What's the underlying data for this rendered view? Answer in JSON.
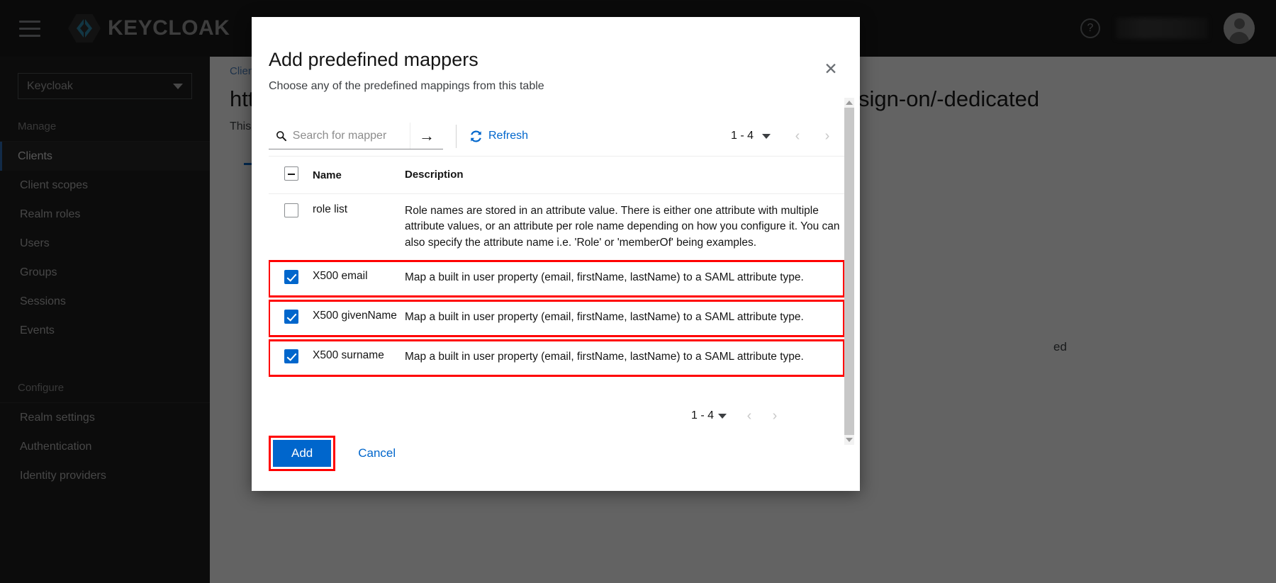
{
  "masthead": {
    "menu_icon": "hamburger-menu-icon",
    "brand_name": "KEYCLOAK",
    "help_icon": "question-circle-icon",
    "username": "",
    "avatar_icon": "user-avatar-icon"
  },
  "sidebar": {
    "realm_selector": {
      "value": "Keycloak",
      "caret_icon": "chevron-down-icon"
    },
    "groups": [
      {
        "title": "Manage",
        "items": [
          {
            "label": "Clients",
            "active": true
          },
          {
            "label": "Client scopes",
            "active": false
          },
          {
            "label": "Realm roles",
            "active": false
          },
          {
            "label": "Users",
            "active": false
          },
          {
            "label": "Groups",
            "active": false
          },
          {
            "label": "Sessions",
            "active": false
          },
          {
            "label": "Events",
            "active": false
          }
        ]
      },
      {
        "title": "Configure",
        "items": [
          {
            "label": "Realm settings",
            "active": false
          },
          {
            "label": "Authentication",
            "active": false
          },
          {
            "label": "Identity providers",
            "active": false
          }
        ]
      }
    ]
  },
  "background_page": {
    "breadcrumb": "Clien",
    "title": "htt",
    "subtitle": "This",
    "title_right": "sign-on/-dedicated",
    "fragment_right": "ed"
  },
  "modal": {
    "title": "Add predefined mappers",
    "description": "Choose any of the predefined mappings from this table",
    "close_icon": "close-icon",
    "toolbar": {
      "search_icon": "search-icon",
      "search_placeholder": "Search for mapper",
      "search_value": "",
      "search_submit_icon": "arrow-right-icon",
      "refresh_icon": "refresh-icon",
      "refresh_label": "Refresh",
      "pagination_count": "1 - 4",
      "pagination_caret_icon": "caret-down-icon",
      "prev_icon": "chevron-left-icon",
      "next_icon": "chevron-right-icon"
    },
    "table": {
      "select_all_state": "indeterminate",
      "columns": [
        "Name",
        "Description"
      ],
      "rows": [
        {
          "name": "role list",
          "description": "Role names are stored in an attribute value. There is either one attribute with multiple attribute values, or an attribute per role name depending on how you configure it. You can also specify the attribute name i.e. 'Role' or 'memberOf' being examples.",
          "checked": false,
          "highlighted": false
        },
        {
          "name": "X500 email",
          "description": "Map a built in user property (email, firstName, lastName) to a SAML attribute type.",
          "checked": true,
          "highlighted": true
        },
        {
          "name": "X500 givenName",
          "description": "Map a built in user property (email, firstName, lastName) to a SAML attribute type.",
          "checked": true,
          "highlighted": true
        },
        {
          "name": "X500 surname",
          "description": "Map a built in user property (email, firstName, lastName) to a SAML attribute type.",
          "checked": true,
          "highlighted": true
        }
      ]
    },
    "bottom_pagination": {
      "count": "1 - 4",
      "caret_icon": "caret-down-icon",
      "prev_icon": "chevron-left-icon",
      "next_icon": "chevron-right-icon"
    },
    "footer": {
      "add_label": "Add",
      "cancel_label": "Cancel"
    },
    "scrollbar": {
      "up_icon": "scroll-up-arrow-icon",
      "down_icon": "scroll-down-arrow-icon"
    }
  },
  "colors": {
    "accent_blue": "#0066CC",
    "highlight_red": "#FF0000",
    "sidebar_bg": "#1B1B1B",
    "masthead_bg": "#151515"
  }
}
